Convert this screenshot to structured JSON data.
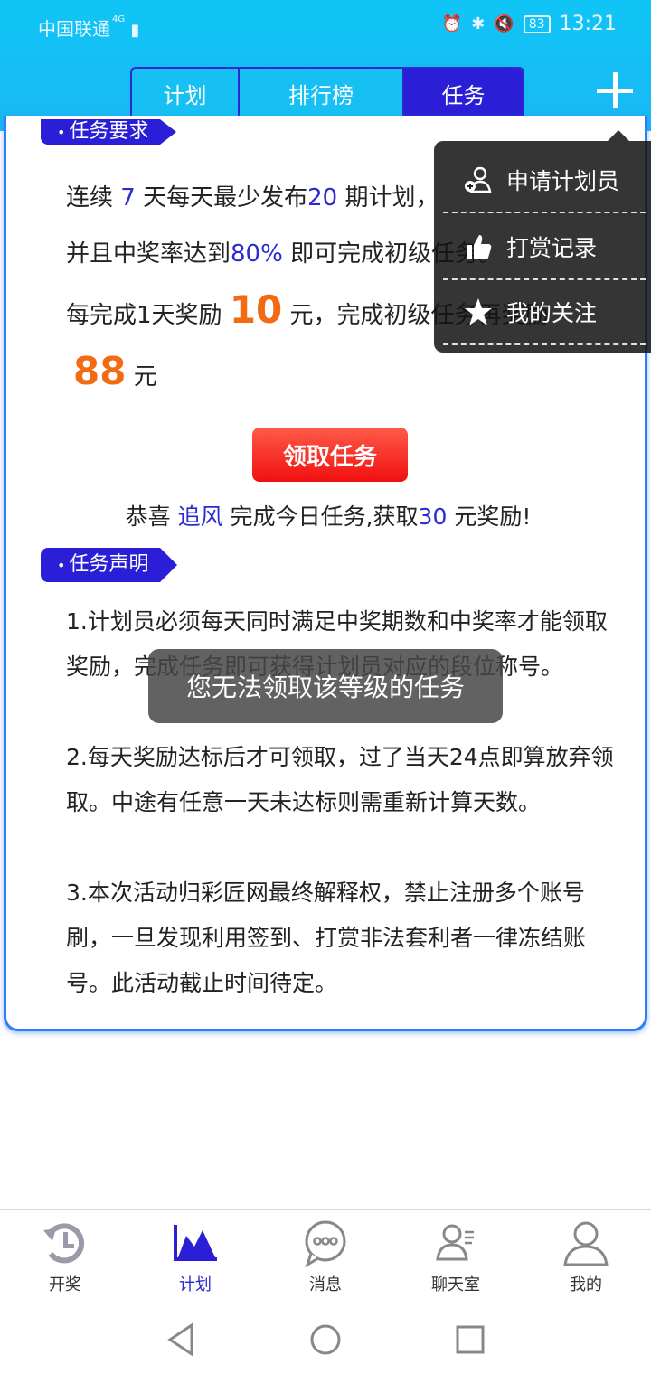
{
  "status_bar": {
    "carrier": "中国联通",
    "signal": "4G",
    "battery": "83",
    "time": "13:21"
  },
  "tabs": [
    {
      "label": "计划"
    },
    {
      "label": "排行榜"
    },
    {
      "label": "任务"
    }
  ],
  "task_requirements": {
    "badge": "任务要求",
    "line1": {
      "pre": "连续",
      "days": "7",
      "mid": "天每天最少发布",
      "count": "20",
      "post": "期计划，"
    },
    "line2": {
      "pre": "并且中奖率达到",
      "rate": "80%",
      "post": "即可完成初级任务。"
    },
    "line3": {
      "pre": "每完成1天奖励",
      "amount": "10",
      "post": "元，完成初级任务再奖励"
    },
    "line4": {
      "amount": "88",
      "unit": "元"
    }
  },
  "claim_button": "领取任务",
  "congrats": {
    "pre": "恭喜",
    "user": "追风",
    "mid": "完成今日任务,获取",
    "amount": "30",
    "post": "元奖励!"
  },
  "declaration": {
    "badge": "任务声明",
    "items": [
      "1.计划员必须每天同时满足中奖期数和中奖率才能领取奖励，完成任务即可获得计划员对应的段位称号。",
      "2.每天奖励达标后才可领取，过了当天24点即算放弃领取。中途有任意一天未达标则需重新计算天数。",
      "3.本次活动归彩匠网最终解释权，禁止注册多个账号刷，一旦发现利用签到、打赏非法套利者一律冻结账号。此活动截止时间待定。"
    ]
  },
  "toast": "您无法领取该等级的任务",
  "dropdown": [
    {
      "label": "申请计划员",
      "icon": "add-user-icon"
    },
    {
      "label": "打赏记录",
      "icon": "thumbs-up-icon"
    },
    {
      "label": "我的关注",
      "icon": "star-icon"
    }
  ],
  "bottom_nav": [
    {
      "label": "开奖",
      "icon": "draw-icon"
    },
    {
      "label": "计划",
      "icon": "chart-icon",
      "active": true
    },
    {
      "label": "消息",
      "icon": "chat-bubble-icon"
    },
    {
      "label": "聊天室",
      "icon": "chatroom-icon"
    },
    {
      "label": "我的",
      "icon": "profile-icon"
    }
  ],
  "colors": {
    "accent": "#2a1fd6",
    "header": "#16c0f2",
    "reward": "#f26a12",
    "button": "#f01010"
  }
}
